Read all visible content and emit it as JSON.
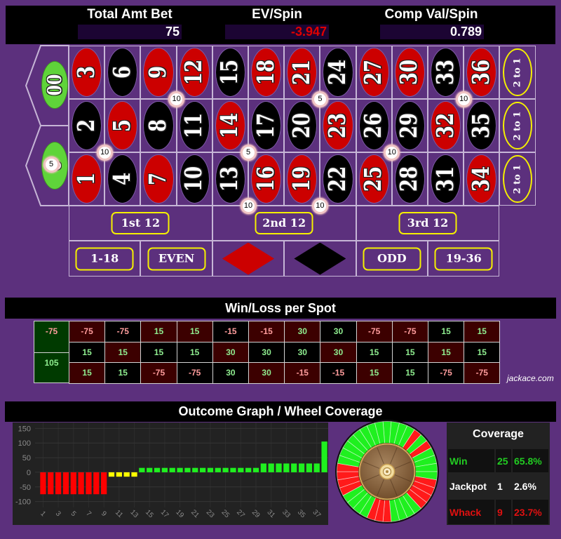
{
  "header": {
    "total_amt_bet": {
      "label": "Total Amt Bet",
      "value": "75"
    },
    "ev_spin": {
      "label": "EV/Spin",
      "value": "-3.947"
    },
    "comp_val_spin": {
      "label": "Comp Val/Spin",
      "value": "0.789"
    }
  },
  "colors": {
    "red": "#cc0000",
    "black": "#000000",
    "green": "#5fd43a",
    "felt": "#5c307d",
    "outline_yellow": "#f5f000",
    "ev_negative": "#e00000",
    "table_red": "#3c0000",
    "table_black": "#000000",
    "table_green": "#003a00",
    "wheel_win": "#1ff01f",
    "wheel_loss": "#ff1a1a"
  },
  "board": {
    "zeros": [
      {
        "n": "00",
        "c": "green"
      },
      {
        "n": "0",
        "c": "green"
      }
    ],
    "rows": [
      [
        {
          "n": "3",
          "c": "red"
        },
        {
          "n": "6",
          "c": "black"
        },
        {
          "n": "9",
          "c": "red"
        },
        {
          "n": "12",
          "c": "red"
        },
        {
          "n": "15",
          "c": "black"
        },
        {
          "n": "18",
          "c": "red"
        },
        {
          "n": "21",
          "c": "red"
        },
        {
          "n": "24",
          "c": "black"
        },
        {
          "n": "27",
          "c": "red"
        },
        {
          "n": "30",
          "c": "red"
        },
        {
          "n": "33",
          "c": "black"
        },
        {
          "n": "36",
          "c": "red"
        }
      ],
      [
        {
          "n": "2",
          "c": "black"
        },
        {
          "n": "5",
          "c": "red"
        },
        {
          "n": "8",
          "c": "black"
        },
        {
          "n": "11",
          "c": "black"
        },
        {
          "n": "14",
          "c": "red"
        },
        {
          "n": "17",
          "c": "black"
        },
        {
          "n": "20",
          "c": "black"
        },
        {
          "n": "23",
          "c": "red"
        },
        {
          "n": "26",
          "c": "black"
        },
        {
          "n": "29",
          "c": "black"
        },
        {
          "n": "32",
          "c": "red"
        },
        {
          "n": "35",
          "c": "black"
        }
      ],
      [
        {
          "n": "1",
          "c": "red"
        },
        {
          "n": "4",
          "c": "black"
        },
        {
          "n": "7",
          "c": "red"
        },
        {
          "n": "10",
          "c": "black"
        },
        {
          "n": "13",
          "c": "black"
        },
        {
          "n": "16",
          "c": "red"
        },
        {
          "n": "19",
          "c": "red"
        },
        {
          "n": "22",
          "c": "black"
        },
        {
          "n": "25",
          "c": "red"
        },
        {
          "n": "28",
          "c": "black"
        },
        {
          "n": "31",
          "c": "black"
        },
        {
          "n": "34",
          "c": "red"
        }
      ]
    ],
    "column_bets": [
      "2 to 1",
      "2 to 1",
      "2 to 1"
    ],
    "dozens": [
      "1st 12",
      "2nd 12",
      "3rd 12"
    ],
    "outside": [
      {
        "label": "1-18"
      },
      {
        "label": "EVEN"
      },
      {
        "shape": "red"
      },
      {
        "shape": "black"
      },
      {
        "label": "ODD"
      },
      {
        "label": "19-36"
      }
    ],
    "chips": [
      {
        "amount": "5",
        "type": "straight",
        "numbers": [
          "0"
        ]
      },
      {
        "amount": "10",
        "type": "corner",
        "numbers": [
          "8",
          "9",
          "11",
          "12"
        ]
      },
      {
        "amount": "10",
        "type": "corner",
        "numbers": [
          "1",
          "2",
          "4",
          "5"
        ]
      },
      {
        "amount": "5",
        "type": "corner",
        "numbers": [
          "13",
          "14",
          "16",
          "17"
        ]
      },
      {
        "amount": "5",
        "type": "corner",
        "numbers": [
          "20",
          "21",
          "23",
          "24"
        ]
      },
      {
        "amount": "10",
        "type": "six-line",
        "numbers": [
          "13",
          "14",
          "15",
          "16",
          "17",
          "18"
        ]
      },
      {
        "amount": "10",
        "type": "six-line",
        "numbers": [
          "19",
          "20",
          "21",
          "22",
          "23",
          "24"
        ]
      },
      {
        "amount": "10",
        "type": "corner",
        "numbers": [
          "25",
          "26",
          "28",
          "29"
        ]
      },
      {
        "amount": "10",
        "type": "corner",
        "numbers": [
          "32",
          "33",
          "35",
          "36"
        ]
      }
    ]
  },
  "winloss": {
    "title": "Win/Loss per Spot",
    "zeros": [
      {
        "n": "00",
        "value": "-75"
      },
      {
        "n": "0",
        "value": "105"
      }
    ],
    "rows": [
      [
        "-75",
        "-75",
        "15",
        "15",
        "-15",
        "-15",
        "30",
        "30",
        "-75",
        "-75",
        "15",
        "15"
      ],
      [
        "15",
        "15",
        "15",
        "15",
        "30",
        "30",
        "30",
        "30",
        "15",
        "15",
        "15",
        "15"
      ],
      [
        "15",
        "15",
        "-75",
        "-75",
        "30",
        "30",
        "-15",
        "-15",
        "15",
        "15",
        "-75",
        "-75"
      ]
    ],
    "watermark": "jackace.com"
  },
  "outcome": {
    "title": "Outcome Graph / Wheel Coverage"
  },
  "chart_data": [
    {
      "type": "bar",
      "title": "Outcome Graph",
      "xlabel": "",
      "ylabel": "",
      "categories": [
        1,
        2,
        3,
        4,
        5,
        6,
        7,
        8,
        9,
        10,
        11,
        12,
        13,
        14,
        15,
        16,
        17,
        18,
        19,
        20,
        21,
        22,
        23,
        24,
        25,
        26,
        27,
        28,
        29,
        30,
        31,
        32,
        33,
        34,
        35,
        36,
        37,
        38
      ],
      "values": [
        -75,
        -75,
        -75,
        -75,
        -75,
        -75,
        -75,
        -75,
        -75,
        -15,
        -15,
        -15,
        -15,
        15,
        15,
        15,
        15,
        15,
        15,
        15,
        15,
        15,
        15,
        15,
        15,
        15,
        15,
        15,
        15,
        30,
        30,
        30,
        30,
        30,
        30,
        30,
        30,
        105
      ],
      "bar_colors": [
        "#ff0000",
        "#ff0000",
        "#ff0000",
        "#ff0000",
        "#ff0000",
        "#ff0000",
        "#ff0000",
        "#ff0000",
        "#ff0000",
        "#ffff00",
        "#ffff00",
        "#ffff00",
        "#ffff00",
        "#1ff01f",
        "#1ff01f",
        "#1ff01f",
        "#1ff01f",
        "#1ff01f",
        "#1ff01f",
        "#1ff01f",
        "#1ff01f",
        "#1ff01f",
        "#1ff01f",
        "#1ff01f",
        "#1ff01f",
        "#1ff01f",
        "#1ff01f",
        "#1ff01f",
        "#1ff01f",
        "#1ff01f",
        "#1ff01f",
        "#1ff01f",
        "#1ff01f",
        "#1ff01f",
        "#1ff01f",
        "#1ff01f",
        "#1ff01f",
        "#1ff01f"
      ],
      "xtick_labels": [
        "1",
        "3",
        "5",
        "7",
        "9",
        "11",
        "13",
        "15",
        "17",
        "19",
        "21",
        "23",
        "25",
        "27",
        "29",
        "31",
        "33",
        "35",
        "37"
      ],
      "yticks": [
        150,
        100,
        50,
        0,
        -50,
        -100
      ],
      "ylim": [
        -120,
        170
      ],
      "grid": true,
      "legend": "none"
    },
    {
      "type": "pie",
      "title": "Wheel Coverage",
      "pockets": [
        {
          "n": "0",
          "result": "win"
        },
        {
          "n": "28",
          "result": "win"
        },
        {
          "n": "9",
          "result": "win"
        },
        {
          "n": "26",
          "result": "win"
        },
        {
          "n": "30",
          "result": "loss"
        },
        {
          "n": "11",
          "result": "win"
        },
        {
          "n": "7",
          "result": "loss"
        },
        {
          "n": "20",
          "result": "win"
        },
        {
          "n": "32",
          "result": "win"
        },
        {
          "n": "17",
          "result": "win"
        },
        {
          "n": "5",
          "result": "win"
        },
        {
          "n": "22",
          "result": "loss"
        },
        {
          "n": "34",
          "result": "loss"
        },
        {
          "n": "15",
          "result": "loss"
        },
        {
          "n": "3",
          "result": "loss"
        },
        {
          "n": "24",
          "result": "win"
        },
        {
          "n": "36",
          "result": "win"
        },
        {
          "n": "13",
          "result": "win"
        },
        {
          "n": "1",
          "result": "win"
        },
        {
          "n": "00",
          "result": "loss"
        },
        {
          "n": "27",
          "result": "loss"
        },
        {
          "n": "10",
          "result": "loss"
        },
        {
          "n": "25",
          "result": "win"
        },
        {
          "n": "29",
          "result": "win"
        },
        {
          "n": "12",
          "result": "win"
        },
        {
          "n": "8",
          "result": "win"
        },
        {
          "n": "19",
          "result": "loss"
        },
        {
          "n": "31",
          "result": "loss"
        },
        {
          "n": "18",
          "result": "loss"
        },
        {
          "n": "6",
          "result": "loss"
        },
        {
          "n": "21",
          "result": "win"
        },
        {
          "n": "33",
          "result": "win"
        },
        {
          "n": "16",
          "result": "win"
        },
        {
          "n": "4",
          "result": "win"
        },
        {
          "n": "23",
          "result": "win"
        },
        {
          "n": "35",
          "result": "win"
        },
        {
          "n": "14",
          "result": "win"
        },
        {
          "n": "2",
          "result": "win"
        }
      ]
    }
  ],
  "coverage": {
    "title": "Coverage",
    "rows": [
      {
        "label": "Win",
        "count": "25",
        "pct": "65.8%",
        "color": "#22cc22"
      },
      {
        "label": "Jackpot",
        "count": "1",
        "pct": "2.6%",
        "color": "#ffffff"
      },
      {
        "label": "Whack",
        "count": "9",
        "pct": "23.7%",
        "color": "#e01010"
      }
    ]
  }
}
